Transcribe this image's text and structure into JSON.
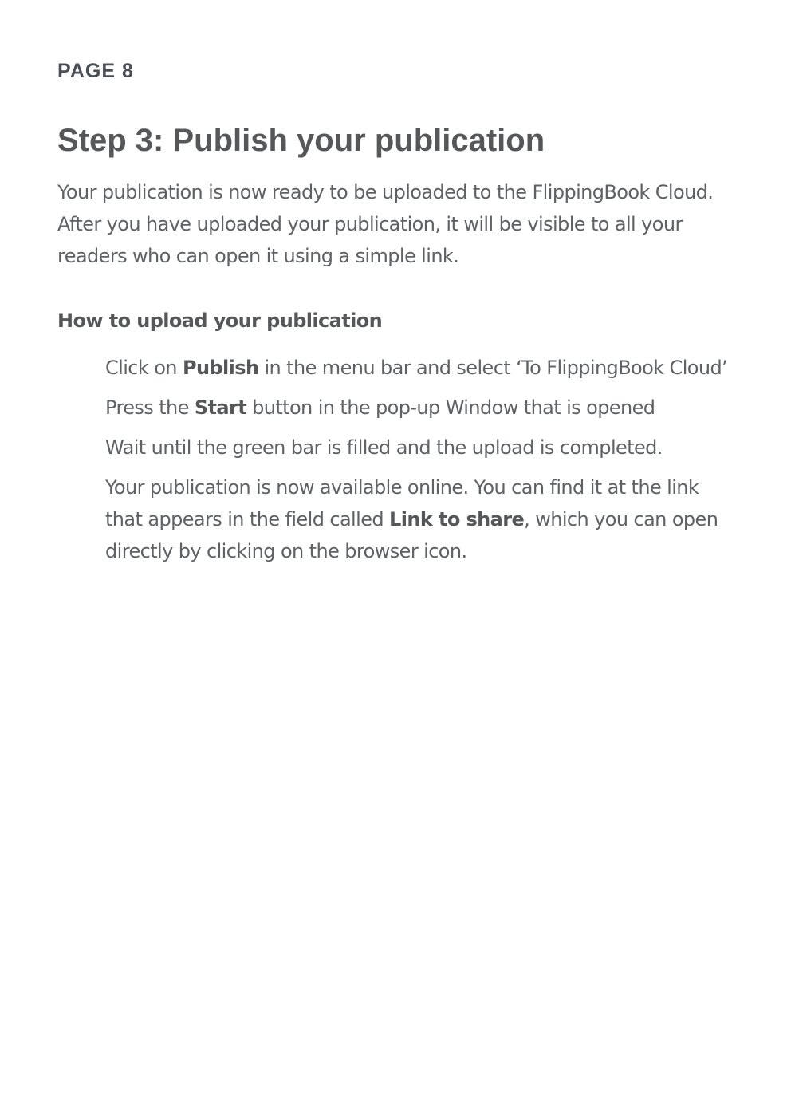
{
  "page": {
    "label": "PAGE 8"
  },
  "title": "Step 3: Publish your publication",
  "intro": "Your publication is now ready to be uploaded to the FlippingBook Cloud. After you have uploaded your publication, it will be visible to all your readers who can open it using a simple link.",
  "how_to": {
    "heading": "How to upload your publication",
    "steps": [
      {
        "before": "Click on ",
        "bold": "Publish",
        "after": " in the menu bar and select ‘To FlippingBook Cloud’"
      },
      {
        "before": "Press the ",
        "bold": "Start",
        "after": " button in the pop-up Window that is opened"
      },
      {
        "text": "Wait until the green bar is filled and the upload is completed."
      },
      {
        "before": "Your publication is now available online. You can find it at the link that appears in the field called ",
        "bold": "Link to share",
        "after": ", which you can open directly by clicking on the browser icon."
      }
    ]
  },
  "colors": {
    "heading": "#555759",
    "body_text": "#5f6265",
    "page_label": "#4a4f55",
    "background": "#ffffff"
  }
}
